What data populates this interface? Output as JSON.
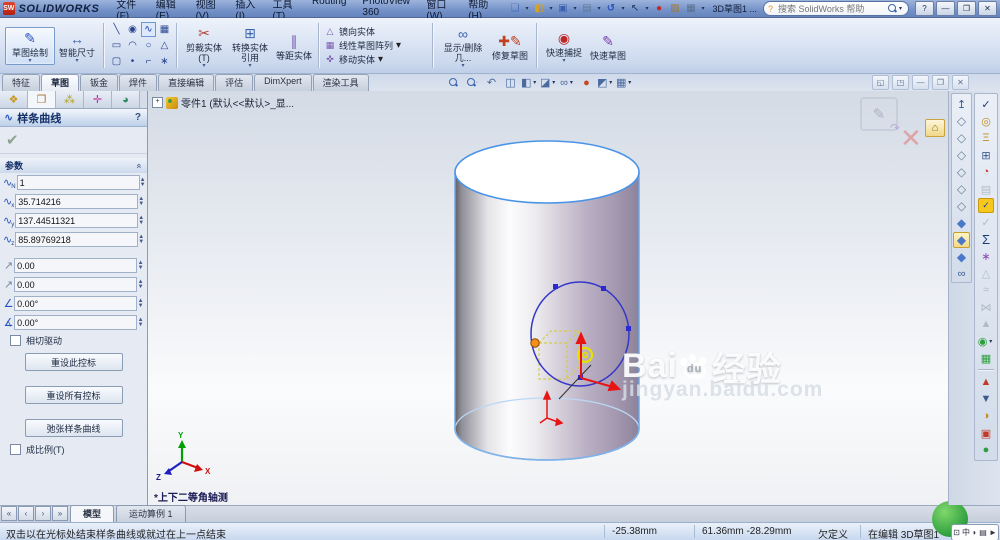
{
  "titlebar": {
    "logo_text": "SW",
    "app_name": "SOLIDWORKS",
    "menus": [
      "文件(F)",
      "编辑(E)",
      "视图(V)",
      "插入(I)",
      "工具(T)",
      "Routing",
      "PhotoView 360",
      "窗口(W)",
      "帮助(H)"
    ],
    "doc_label": "3D草图1 ...",
    "search_placeholder": "搜索 SolidWorks 帮助"
  },
  "command_manager": {
    "sketch": "草图绘制",
    "smart_dimension": "智能尺寸",
    "trim": "剪裁实体(T)",
    "convert": "转换实体引用",
    "offset": "等距实体",
    "mirror": "镜向实体",
    "linear_pattern": "线性草图阵列",
    "move": "移动实体",
    "display_delete": "显示/删除几...",
    "repair": "修复草图",
    "quick_snaps": "快速捕捉",
    "rapid_sketch": "快速草图"
  },
  "ribbon_tabs": [
    "特征",
    "草图",
    "钣金",
    "焊件",
    "直接编辑",
    "评估",
    "DimXpert",
    "渲染工具"
  ],
  "property_panel": {
    "title": "样条曲线",
    "help": "?",
    "section": "参数",
    "params": {
      "n": "1",
      "x": "35.714216",
      "y": "137.44511321",
      "z": "85.89769218",
      "w1": "0.00",
      "w2": "0.00",
      "a1": "0.00°",
      "a2": "0.00°"
    },
    "tangent_driving": "相切驱动",
    "reset_handle": "重设此控标",
    "reset_all": "重设所有控标",
    "relax": "弛张样条曲线",
    "proportional": "成比例(T)"
  },
  "viewport": {
    "feature_tree": "零件1 (默认<<默认>_显...",
    "view_label": "*上下二等角轴测",
    "axis": {
      "x": "X",
      "y": "Y",
      "z": "Z"
    },
    "watermark": {
      "p1": "Bai",
      "p2": "du",
      "p3": "经验",
      "url": "jingyan.baidu.com"
    }
  },
  "bottom_tabs": {
    "model": "模型",
    "motion": "运动算例 1"
  },
  "statusbar": {
    "message": "双击以在光标处结束样条曲线或就过在上一点结束",
    "coord_x": "-25.38mm",
    "coord_yz": "61.36mm -28.29mm",
    "state": "欠定义",
    "editing": "在编辑 3D草图1",
    "ime": "中"
  },
  "icons": {
    "titlebar_quick": [
      "new-document",
      "open",
      "save",
      "print",
      "undo",
      "select",
      "rebuild",
      "file-properties",
      "options"
    ],
    "headsup": [
      "zoom-fit",
      "zoom-area",
      "previous-view",
      "section-view",
      "view-orientation",
      "display-style",
      "hide-show-items",
      "edit-appearance",
      "apply-scene",
      "view-settings"
    ],
    "panel_tabs": [
      "feature-manager",
      "property-manager",
      "configuration-manager",
      "dimxpert-manager",
      "display-manager"
    ],
    "right_view_toolbar": [
      "normal-to",
      "view-front",
      "view-back",
      "view-left",
      "view-right",
      "view-top",
      "view-bottom",
      "view-isometric",
      "view-trimetric",
      "view-dimetric",
      "link-views",
      "home"
    ],
    "right_tools_toolbar": [
      "spell-check",
      "measure",
      "mass-properties",
      "section-properties",
      "sensor",
      "statistics",
      "check-sketch",
      "check",
      "equations",
      "curvature",
      "deviation-analysis",
      "zebra-stripes",
      "symmetry-check",
      "parting-line-analysis",
      "relations",
      "design-table",
      "simulation",
      "flow-simulation",
      "costing",
      "compare",
      "sustainability"
    ]
  }
}
